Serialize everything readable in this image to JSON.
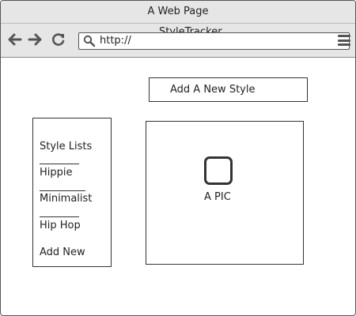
{
  "window": {
    "title": "A Web Page"
  },
  "toolbar": {
    "back_icon": "back-arrow-icon",
    "forward_icon": "forward-arrow-icon",
    "reload_icon": "reload-icon",
    "url": "http://",
    "menu_icon": "hamburger-menu-icon",
    "app_name": "StyleTracker"
  },
  "main": {
    "add_button_label": "Add A New Style",
    "picture_label": "A PIC",
    "picture_icon": "image-placeholder-icon"
  },
  "sidebar": {
    "heading": "Style Lists",
    "items": [
      {
        "label": "Hippie"
      },
      {
        "label": "Minimalist"
      },
      {
        "label": "Hip Hop"
      }
    ],
    "add_new_label": "Add New"
  }
}
